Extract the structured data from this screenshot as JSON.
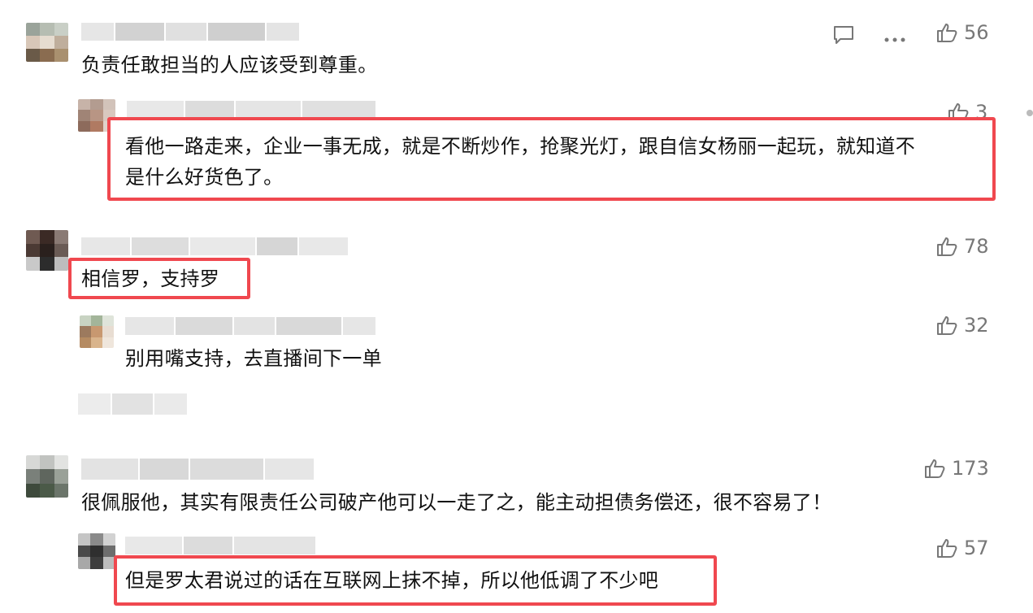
{
  "comments": [
    {
      "text": "负责任敢担当的人应该受到尊重。",
      "likes": "56"
    },
    {
      "text_line1": "看他一路走来，企业一事无成，就是不断炒作，抢聚光灯，跟自信女杨丽一起玩，就知道不",
      "text_line2": "是什么好货色了。",
      "likes": "3"
    },
    {
      "text": "相信罗，支持罗",
      "likes": "78"
    },
    {
      "text": "别用嘴支持，去直播间下一单",
      "likes": "32"
    },
    {
      "text": "很佩服他，其实有限责任公司破产他可以一走了之，能主动担债务偿还，很不容易了！",
      "likes": "173"
    },
    {
      "text": "但是罗太君说过的话在互联网上抹不掉，所以他低调了不少吧",
      "likes": "57"
    }
  ],
  "colors": {
    "highlight": "#f0484f",
    "muted": "#777777"
  },
  "icons": [
    "comment-icon",
    "more-icon",
    "thumbs-up-icon"
  ]
}
